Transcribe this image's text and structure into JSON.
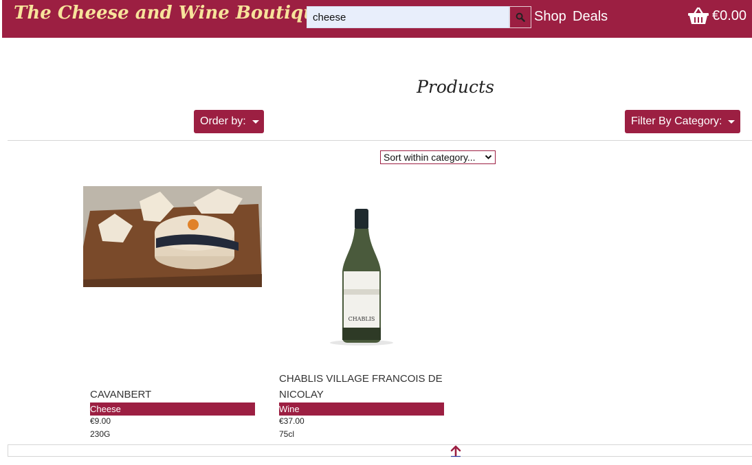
{
  "header": {
    "brand": "The Cheese and Wine Boutique",
    "search_value": "cheese",
    "nav": {
      "shop": "Shop",
      "deals": "Deals"
    },
    "basket_total": "€0.00",
    "colors": {
      "primary": "#9c1f42",
      "brand_text": "#f7e39b"
    }
  },
  "main": {
    "title": "Products",
    "order_by_label": "Order by:",
    "filter_label": "Filter By Category:",
    "sort_select": "Sort within category..."
  },
  "products": [
    {
      "name": "CAVANBERT",
      "category": "Cheese",
      "price": "€9.00",
      "size": "230G",
      "image": "cheese-wheel-photo"
    },
    {
      "name_line1": "CHABLIS VILLAGE FRANCOIS DE",
      "name_line2": "NICOLAY",
      "category": "Wine",
      "price": "€37.00",
      "size": "75cl",
      "image": "wine-bottle-photo",
      "bottle_label": "CHABLIS"
    }
  ],
  "icons": {
    "search": "search-icon",
    "basket": "basket-icon",
    "back_to_top": "arrow-up-icon"
  }
}
